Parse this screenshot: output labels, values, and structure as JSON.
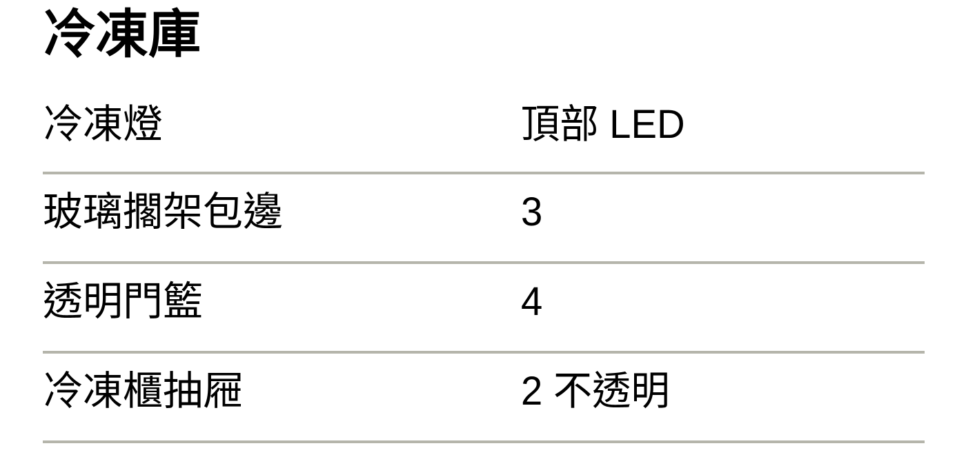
{
  "panel": {
    "title": "冷凍庫",
    "rows": [
      {
        "label": "冷凍燈",
        "value": "頂部 LED"
      },
      {
        "label": "玻璃擱架包邊",
        "value": "3"
      },
      {
        "label": "透明門籃",
        "value": "4"
      },
      {
        "label": "冷凍櫃抽屜",
        "value": "2 不透明"
      }
    ]
  },
  "style": {
    "background_color": "#ffffff",
    "text_color": "#000000",
    "divider_color": "#b5b5ab"
  }
}
